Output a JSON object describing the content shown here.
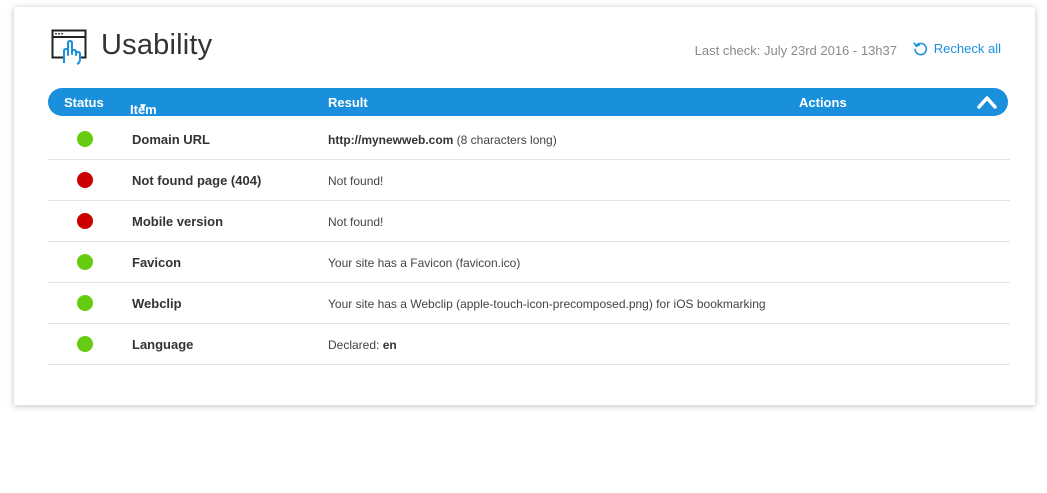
{
  "header": {
    "title": "Usability",
    "last_check": "Last check: July 23rd 2016 - 13h37",
    "recheck_label": "Recheck all"
  },
  "table": {
    "columns": {
      "status": "Status",
      "item": "Item",
      "result": "Result",
      "actions": "Actions"
    },
    "rows": [
      {
        "status": "pass",
        "item": "Domain URL",
        "result_strong": "http://mynewweb.com",
        "result_text": " (8 characters long)"
      },
      {
        "status": "fail",
        "item": "Not found page (404)",
        "result_strong": "",
        "result_text": "Not found!"
      },
      {
        "status": "fail",
        "item": "Mobile version",
        "result_strong": "",
        "result_text": "Not found!"
      },
      {
        "status": "pass",
        "item": "Favicon",
        "result_strong": "",
        "result_text": "Your site has a Favicon (favicon.ico)"
      },
      {
        "status": "pass",
        "item": "Webclip",
        "result_strong": "",
        "result_text": "Your site has a Webclip (apple-touch-icon-precomposed.png) for iOS bookmarking"
      },
      {
        "status": "pass",
        "item": "Language",
        "result_prefix": "Declared: ",
        "result_strong_after": "en"
      }
    ]
  },
  "colors": {
    "accent": "#1a90dc",
    "pass": "#66cc11",
    "fail": "#cc0000"
  },
  "icons": {
    "title": "browser-pointer-icon",
    "recheck": "refresh-icon",
    "sort": "caret-down-icon",
    "collapse": "chevron-up-icon"
  }
}
